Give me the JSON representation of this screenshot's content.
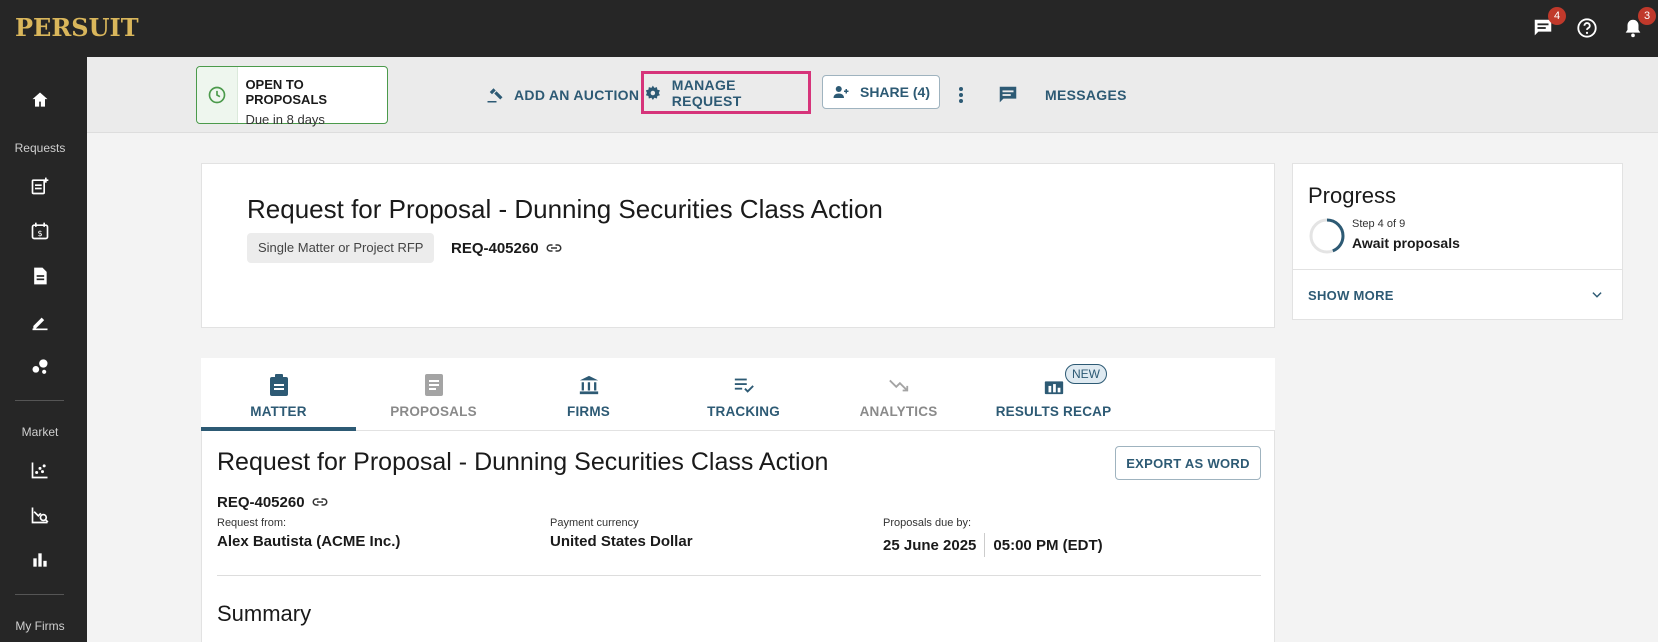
{
  "app": {
    "logo": "PERSUIT"
  },
  "topbar": {
    "messages_badge": "4",
    "notifications_badge": "3"
  },
  "sidebar": {
    "requests_label": "Requests",
    "market_label": "Market",
    "myfirms_label": "My Firms"
  },
  "actionbar": {
    "status_title": "OPEN TO PROPOSALS",
    "status_sub": "Due in 8 days",
    "add_auction": "ADD AN AUCTION",
    "manage_request": "MANAGE REQUEST",
    "share": "SHARE (4)",
    "messages": "MESSAGES"
  },
  "header": {
    "title": "Request for Proposal - Dunning Securities Class Action",
    "type_tag": "Single Matter or Project RFP",
    "req_id": "REQ-405260"
  },
  "progress": {
    "title": "Progress",
    "step": "Step 4 of 9",
    "step_name": "Await proposals",
    "step_fraction": 0.44,
    "show_more": "SHOW MORE"
  },
  "tabs": [
    {
      "label": "MATTER",
      "active": true
    },
    {
      "label": "PROPOSALS",
      "active": false
    },
    {
      "label": "FIRMS",
      "active": false
    },
    {
      "label": "TRACKING",
      "active": false
    },
    {
      "label": "ANALYTICS",
      "active": false
    },
    {
      "label": "RESULTS RECAP",
      "active": false,
      "badge": "NEW"
    }
  ],
  "content": {
    "title": "Request for Proposal - Dunning Securities Class Action",
    "export": "EXPORT AS WORD",
    "req_id": "REQ-405260",
    "request_from_label": "Request from:",
    "request_from": "Alex Bautista (ACME Inc.)",
    "currency_label": "Payment currency",
    "currency": "United States Dollar",
    "due_label": "Proposals due by:",
    "due_date": "25 June 2025",
    "due_time": "05:00 PM (EDT)",
    "summary": "Summary"
  },
  "colors": {
    "accent": "#2d5a74",
    "highlight": "#d6347a",
    "status_green": "#4b9a4b",
    "dark_bg": "#262626",
    "logo_gold": "#d9b65b"
  }
}
